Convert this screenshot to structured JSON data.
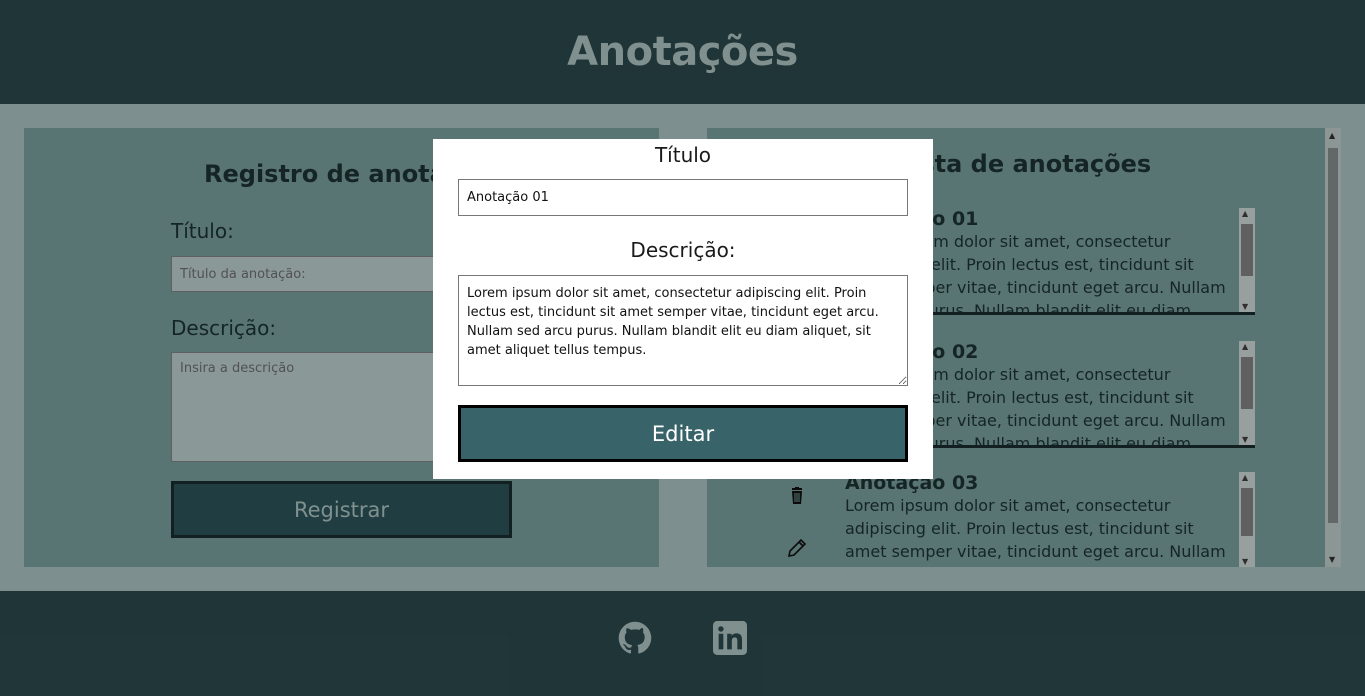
{
  "header": {
    "title": "Anotações"
  },
  "register": {
    "heading": "Registro de anotações",
    "title_label": "Título:",
    "title_placeholder": "Título da anotação:",
    "desc_label": "Descrição:",
    "desc_placeholder": "Insira a descrição",
    "button_label": "Registrar"
  },
  "list": {
    "heading": "Lista de anotações",
    "notes": [
      {
        "title": "Anotação 01",
        "body": "Lorem ipsum dolor sit amet, consectetur adipiscing elit. Proin lectus est, tincidunt sit amet semper vitae, tincidunt eget arcu. Nullam sed arcu purus. Nullam blandit elit eu diam aliquet, sit amet aliquet tellus tempus."
      },
      {
        "title": "Anotação 02",
        "body": "Lorem ipsum dolor sit amet, consectetur adipiscing elit. Proin lectus est, tincidunt sit amet semper vitae, tincidunt eget arcu. Nullam sed arcu purus. Nullam blandit elit eu diam aliquet, sit amet aliquet tellus tempus."
      },
      {
        "title": "Anotação 03",
        "body": "Lorem ipsum dolor sit amet, consectetur adipiscing elit. Proin lectus est, tincidunt sit amet semper vitae, tincidunt eget arcu. Nullam sed arcu purus."
      }
    ]
  },
  "modal": {
    "title_label": "Título",
    "title_value": "Anotação 01",
    "desc_label": "Descrição:",
    "desc_value": "Lorem ipsum dolor sit amet, consectetur adipiscing elit. Proin lectus est, tincidunt sit amet semper vitae, tincidunt eget arcu. Nullam sed arcu purus. Nullam blandit elit eu diam aliquet, sit amet aliquet tellus tempus.",
    "button_label": "Editar"
  },
  "footer": {
    "icons": [
      "github-icon",
      "linkedin-icon"
    ]
  },
  "colors": {
    "header_bg": "#2f4d50",
    "panel_bg": "#7fa7a5",
    "accent": "#386469",
    "page_bg": "#b3cfcd"
  }
}
